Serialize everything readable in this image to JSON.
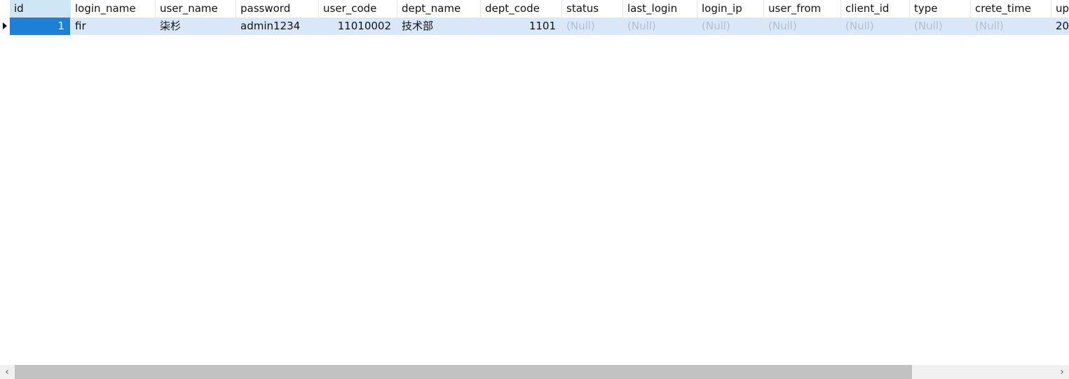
{
  "table": {
    "columns": [
      "id",
      "login_name",
      "user_name",
      "password",
      "user_code",
      "dept_name",
      "dept_code",
      "status",
      "last_login",
      "login_ip",
      "user_from",
      "client_id",
      "type",
      "crete_time",
      "up"
    ],
    "rows": [
      {
        "id": "1",
        "login_name": "fir",
        "user_name": "柒杉",
        "password": "admin1234",
        "user_code": "11010002",
        "dept_name": "技术部",
        "dept_code": "1101",
        "status": "(Null)",
        "last_login": "(Null)",
        "login_ip": "(Null)",
        "user_from": "(Null)",
        "client_id": "(Null)",
        "type": "(Null)",
        "crete_time": "(Null)",
        "up": "20"
      }
    ]
  },
  "scrollbar": {
    "left_arrow": "‹",
    "right_arrow": "›"
  },
  "colors": {
    "selected_cell": "#1e7fd6",
    "row_highlight": "#d9e8f8",
    "null_text": "#b5bfcc"
  }
}
